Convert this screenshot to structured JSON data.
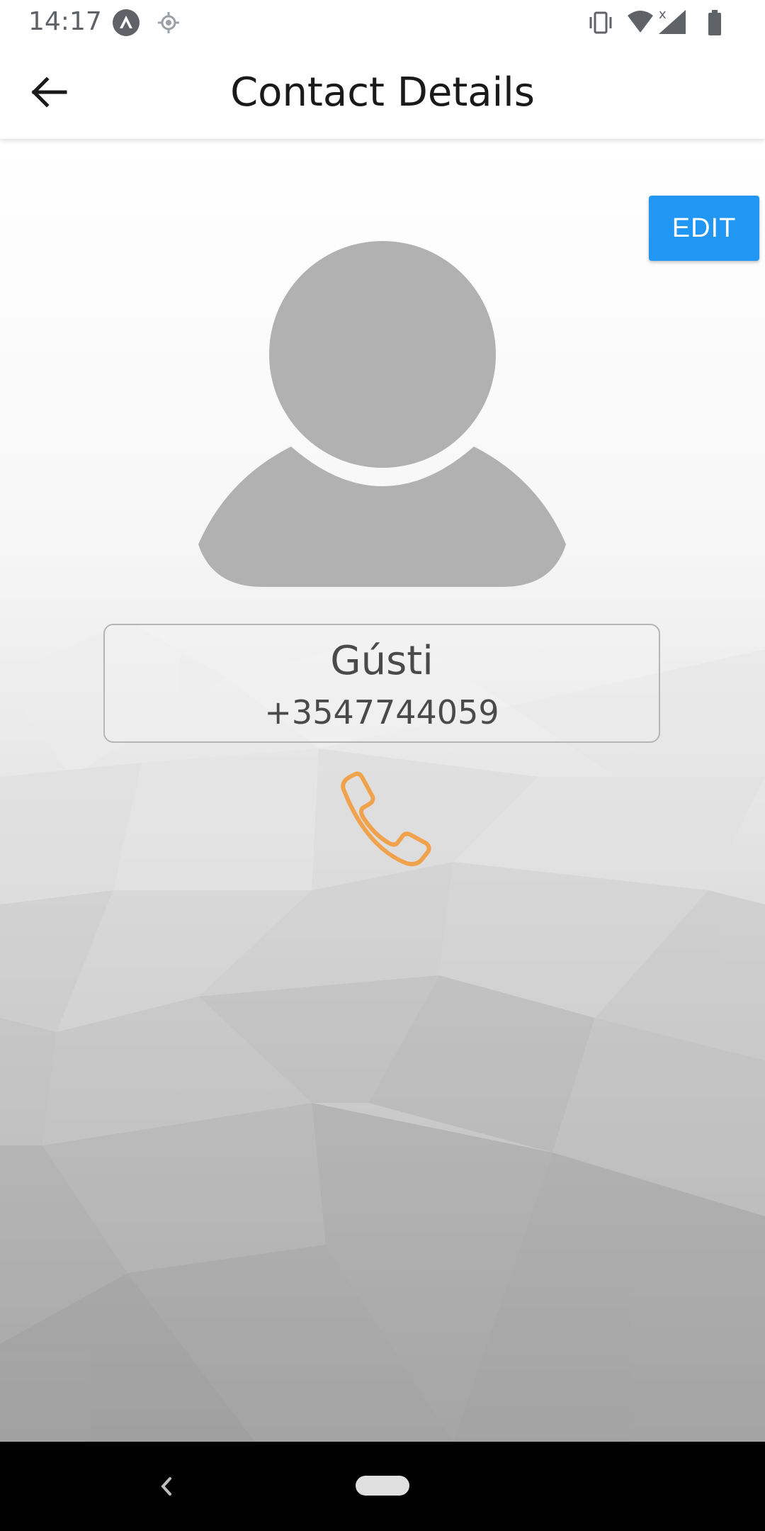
{
  "status_bar": {
    "time": "14:17",
    "left_icons": [
      "app-notification-icon",
      "location-icon"
    ],
    "right_icons": [
      "vibrate-icon",
      "wifi-icon",
      "signal-icon",
      "battery-icon"
    ]
  },
  "app_bar": {
    "title": "Contact Details",
    "back_icon": "arrow-back-icon"
  },
  "actions": {
    "edit_label": "EDIT"
  },
  "contact": {
    "avatar_icon": "person-placeholder-icon",
    "name": "Gústi",
    "phone": "+3547744059",
    "call_icon": "phone-icon"
  },
  "nav_bar": {
    "back_icon": "nav-back-icon",
    "home_icon": "nav-home-pill"
  },
  "colors": {
    "accent": "#2196f3",
    "call_icon": "#f0a24d",
    "avatar": "#b1b1b1",
    "text": "#4a4a4a"
  }
}
